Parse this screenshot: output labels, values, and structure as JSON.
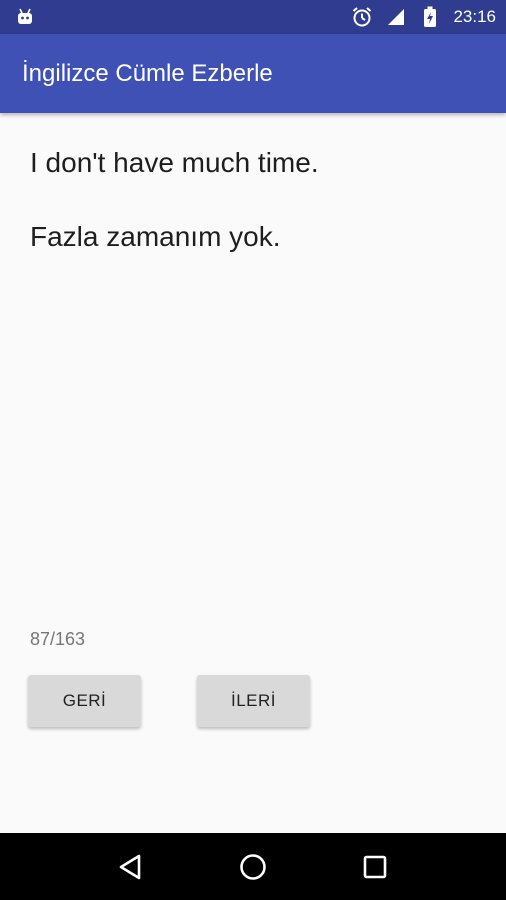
{
  "status_bar": {
    "time": "23:16",
    "icons": [
      "android-notification-icon",
      "alarm-icon",
      "signal-icon",
      "battery-charging-icon"
    ]
  },
  "app_bar": {
    "title": "İngilizce Cümle Ezberle"
  },
  "card": {
    "english_sentence": "I don't have much time.",
    "turkish_sentence": "Fazla zamanım yok.",
    "counter": "87/163"
  },
  "buttons": {
    "back_label": "GERİ",
    "next_label": "İLERİ"
  },
  "nav_bar": {
    "icons": [
      "back-triangle-icon",
      "home-circle-icon",
      "recents-square-icon"
    ]
  },
  "colors": {
    "status_bar": "#2f3c8f",
    "app_bar": "#3f51b5",
    "background": "#fafafa",
    "button": "#d9d9d9",
    "nav_bar": "#000000"
  }
}
